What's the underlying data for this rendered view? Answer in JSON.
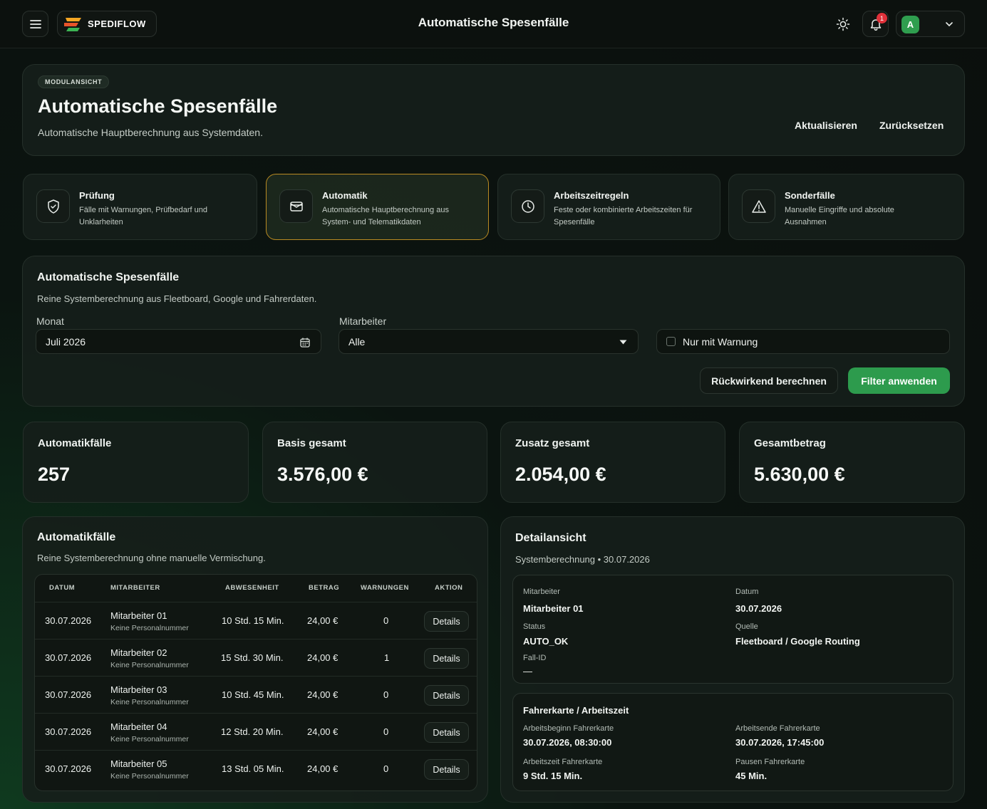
{
  "topbar": {
    "brand": "SPEDIFLOW",
    "title": "Automatische Spesenfälle",
    "notifications": "1",
    "user_initial": "A"
  },
  "hero": {
    "tag": "MODULANSICHT",
    "title": "Automatische Spesenfälle",
    "subtitle": "Automatische Hauptberechnung aus Systemdaten.",
    "refresh": "Aktualisieren",
    "reset": "Zurücksetzen"
  },
  "modules": [
    {
      "title": "Prüfung",
      "desc": "Fälle mit Warnungen, Prüfbedarf und Unklarheiten",
      "icon": "shield-check-icon"
    },
    {
      "title": "Automatik",
      "desc": "Automatische Hauptberechnung aus System- und Telematikdaten",
      "icon": "mail-icon"
    },
    {
      "title": "Arbeitszeitregeln",
      "desc": "Feste oder kombinierte Arbeitszeiten für Spesenfälle",
      "icon": "clock-icon"
    },
    {
      "title": "Sonderfälle",
      "desc": "Manuelle Eingriffe und absolute Ausnahmen",
      "icon": "warning-icon"
    }
  ],
  "filters": {
    "title": "Automatische Spesenfälle",
    "subtitle": "Reine Systemberechnung aus Fleetboard, Google und Fahrerdaten.",
    "month_label": "Monat",
    "month_value": "Juli 2026",
    "employee_label": "Mitarbeiter",
    "employee_value": "Alle",
    "warning_only": "Nur mit Warnung",
    "recalc": "Rückwirkend berechnen",
    "apply": "Filter anwenden"
  },
  "stats": [
    {
      "label": "Automatikfälle",
      "value": "257"
    },
    {
      "label": "Basis gesamt",
      "value": "3.576,00 €"
    },
    {
      "label": "Zusatz gesamt",
      "value": "2.054,00 €"
    },
    {
      "label": "Gesamtbetrag",
      "value": "5.630,00 €"
    }
  ],
  "cases": {
    "title": "Automatikfälle",
    "subtitle": "Reine Systemberechnung ohne manuelle Vermischung.",
    "headers": [
      "DATUM",
      "MITARBEITER",
      "ABWESENHEIT",
      "BETRAG",
      "WARNUNGEN",
      "AKTION"
    ],
    "rows": [
      {
        "date": "30.07.2026",
        "name": "Mitarbeiter 01",
        "sub": "Keine Personalnummer",
        "absence": "10 Std. 15 Min.",
        "amount": "24,00 €",
        "warnings": "0",
        "action": "Details"
      },
      {
        "date": "30.07.2026",
        "name": "Mitarbeiter 02",
        "sub": "Keine Personalnummer",
        "absence": "15 Std. 30 Min.",
        "amount": "24,00 €",
        "warnings": "1",
        "action": "Details"
      },
      {
        "date": "30.07.2026",
        "name": "Mitarbeiter 03",
        "sub": "Keine Personalnummer",
        "absence": "10 Std. 45 Min.",
        "amount": "24,00 €",
        "warnings": "0",
        "action": "Details"
      },
      {
        "date": "30.07.2026",
        "name": "Mitarbeiter 04",
        "sub": "Keine Personalnummer",
        "absence": "12 Std. 20 Min.",
        "amount": "24,00 €",
        "warnings": "0",
        "action": "Details"
      },
      {
        "date": "30.07.2026",
        "name": "Mitarbeiter 05",
        "sub": "Keine Personalnummer",
        "absence": "13 Std. 05 Min.",
        "amount": "24,00 €",
        "warnings": "0",
        "action": "Details"
      }
    ]
  },
  "detail": {
    "title": "Detailansicht",
    "subtitle": "Systemberechnung • 30.07.2026",
    "employee_label": "Mitarbeiter",
    "employee": "Mitarbeiter 01",
    "date_label": "Datum",
    "date": "30.07.2026",
    "status_label": "Status",
    "status": "AUTO_OK",
    "source_label": "Quelle",
    "source": "Fleetboard / Google Routing",
    "case_id_label": "Fall-ID",
    "case_id": "—",
    "card_title": "Fahrerkarte / Arbeitszeit",
    "start_label": "Arbeitsbeginn Fahrerkarte",
    "start": "30.07.2026, 08:30:00",
    "end_label": "Arbeitsende Fahrerkarte",
    "end": "30.07.2026, 17:45:00",
    "worktime_label": "Arbeitszeit Fahrerkarte",
    "worktime": "9 Std. 15 Min.",
    "breaks_label": "Pausen Fahrerkarte",
    "breaks": "45 Min."
  },
  "colors": {
    "accent": "#2d9b4d",
    "active_border": "#b98a22",
    "badge": "#e0313a"
  }
}
